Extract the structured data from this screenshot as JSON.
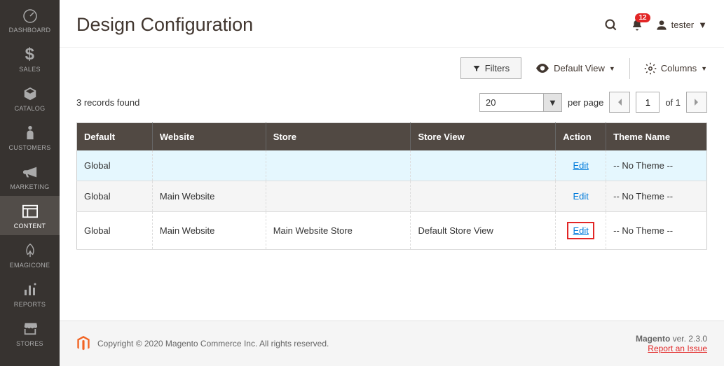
{
  "sidebar": {
    "items": [
      {
        "label": "DASHBOARD",
        "icon": "dashboard"
      },
      {
        "label": "SALES",
        "icon": "dollar"
      },
      {
        "label": "CATALOG",
        "icon": "box"
      },
      {
        "label": "CUSTOMERS",
        "icon": "person"
      },
      {
        "label": "MARKETING",
        "icon": "megaphone"
      },
      {
        "label": "CONTENT",
        "icon": "layout"
      },
      {
        "label": "EMAGICONE",
        "icon": "leaf"
      },
      {
        "label": "REPORTS",
        "icon": "bars"
      },
      {
        "label": "STORES",
        "icon": "store"
      }
    ],
    "activeIndex": 5
  },
  "header": {
    "title": "Design Configuration",
    "notificationCount": "12",
    "username": "tester"
  },
  "toolbar": {
    "filters": "Filters",
    "defaultView": "Default View",
    "columns": "Columns"
  },
  "controls": {
    "recordsFound": "3 records found",
    "pageSize": "20",
    "perPage": "per page",
    "currentPage": "1",
    "ofText": "of 1"
  },
  "table": {
    "headers": [
      "Default",
      "Website",
      "Store",
      "Store View",
      "Action",
      "Theme Name"
    ],
    "rows": [
      {
        "default": "Global",
        "website": "",
        "store": "",
        "storeView": "",
        "action": "Edit",
        "theme": "-- No Theme --",
        "highlight": true,
        "editBox": false,
        "underline": true
      },
      {
        "default": "Global",
        "website": "Main Website",
        "store": "",
        "storeView": "",
        "action": "Edit",
        "theme": "-- No Theme --",
        "alt": true,
        "editBox": false,
        "underline": false
      },
      {
        "default": "Global",
        "website": "Main Website",
        "store": "Main Website Store",
        "storeView": "Default Store View",
        "action": "Edit",
        "theme": "-- No Theme --",
        "editBox": true,
        "underline": true
      }
    ]
  },
  "footer": {
    "copyright": "Copyright © 2020 Magento Commerce Inc. All rights reserved.",
    "brand": "Magento",
    "version": " ver. 2.3.0",
    "issue": "Report an Issue"
  }
}
